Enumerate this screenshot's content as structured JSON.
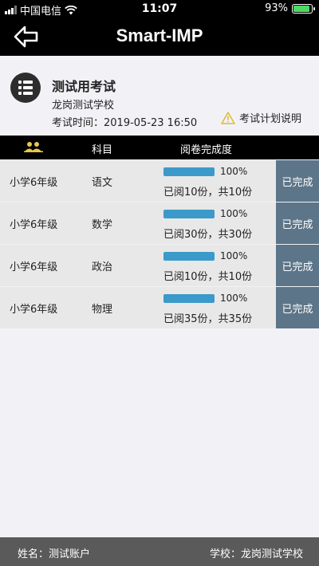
{
  "status_bar": {
    "carrier": "中国电信",
    "time": "11:07",
    "battery": "93%",
    "battery_level": 0.93
  },
  "nav": {
    "title": "Smart-IMP",
    "back_icon": "back-arrow-icon"
  },
  "exam": {
    "icon": "list-icon",
    "title": "测试用考试",
    "school": "龙岗测试学校",
    "time": "考试时间：2019-05-23 16:50",
    "plan_link": "考试计划说明",
    "plan_icon": "warning-triangle-icon"
  },
  "table": {
    "header_icon": "group-icon",
    "col_subject": "科目",
    "col_progress": "阅卷完成度",
    "rows": [
      {
        "grade": "小学6年级",
        "subject": "语文",
        "percent": "100%",
        "progress": 1.0,
        "count": "已阅10份，共10份",
        "status": "已完成"
      },
      {
        "grade": "小学6年级",
        "subject": "数学",
        "percent": "100%",
        "progress": 1.0,
        "count": "已阅30份，共30份",
        "status": "已完成"
      },
      {
        "grade": "小学6年级",
        "subject": "政治",
        "percent": "100%",
        "progress": 1.0,
        "count": "已阅10份，共10份",
        "status": "已完成"
      },
      {
        "grade": "小学6年级",
        "subject": "物理",
        "percent": "100%",
        "progress": 1.0,
        "count": "已阅35份，共35份",
        "status": "已完成"
      }
    ]
  },
  "footer": {
    "name": "姓名：测试账户",
    "school": "学校：龙岗测试学校"
  },
  "colors": {
    "progress_fill": "#3b9ac9",
    "status_button": "#5c7589",
    "header_icon": "#e8c74a",
    "warning": "#e0b83a"
  }
}
